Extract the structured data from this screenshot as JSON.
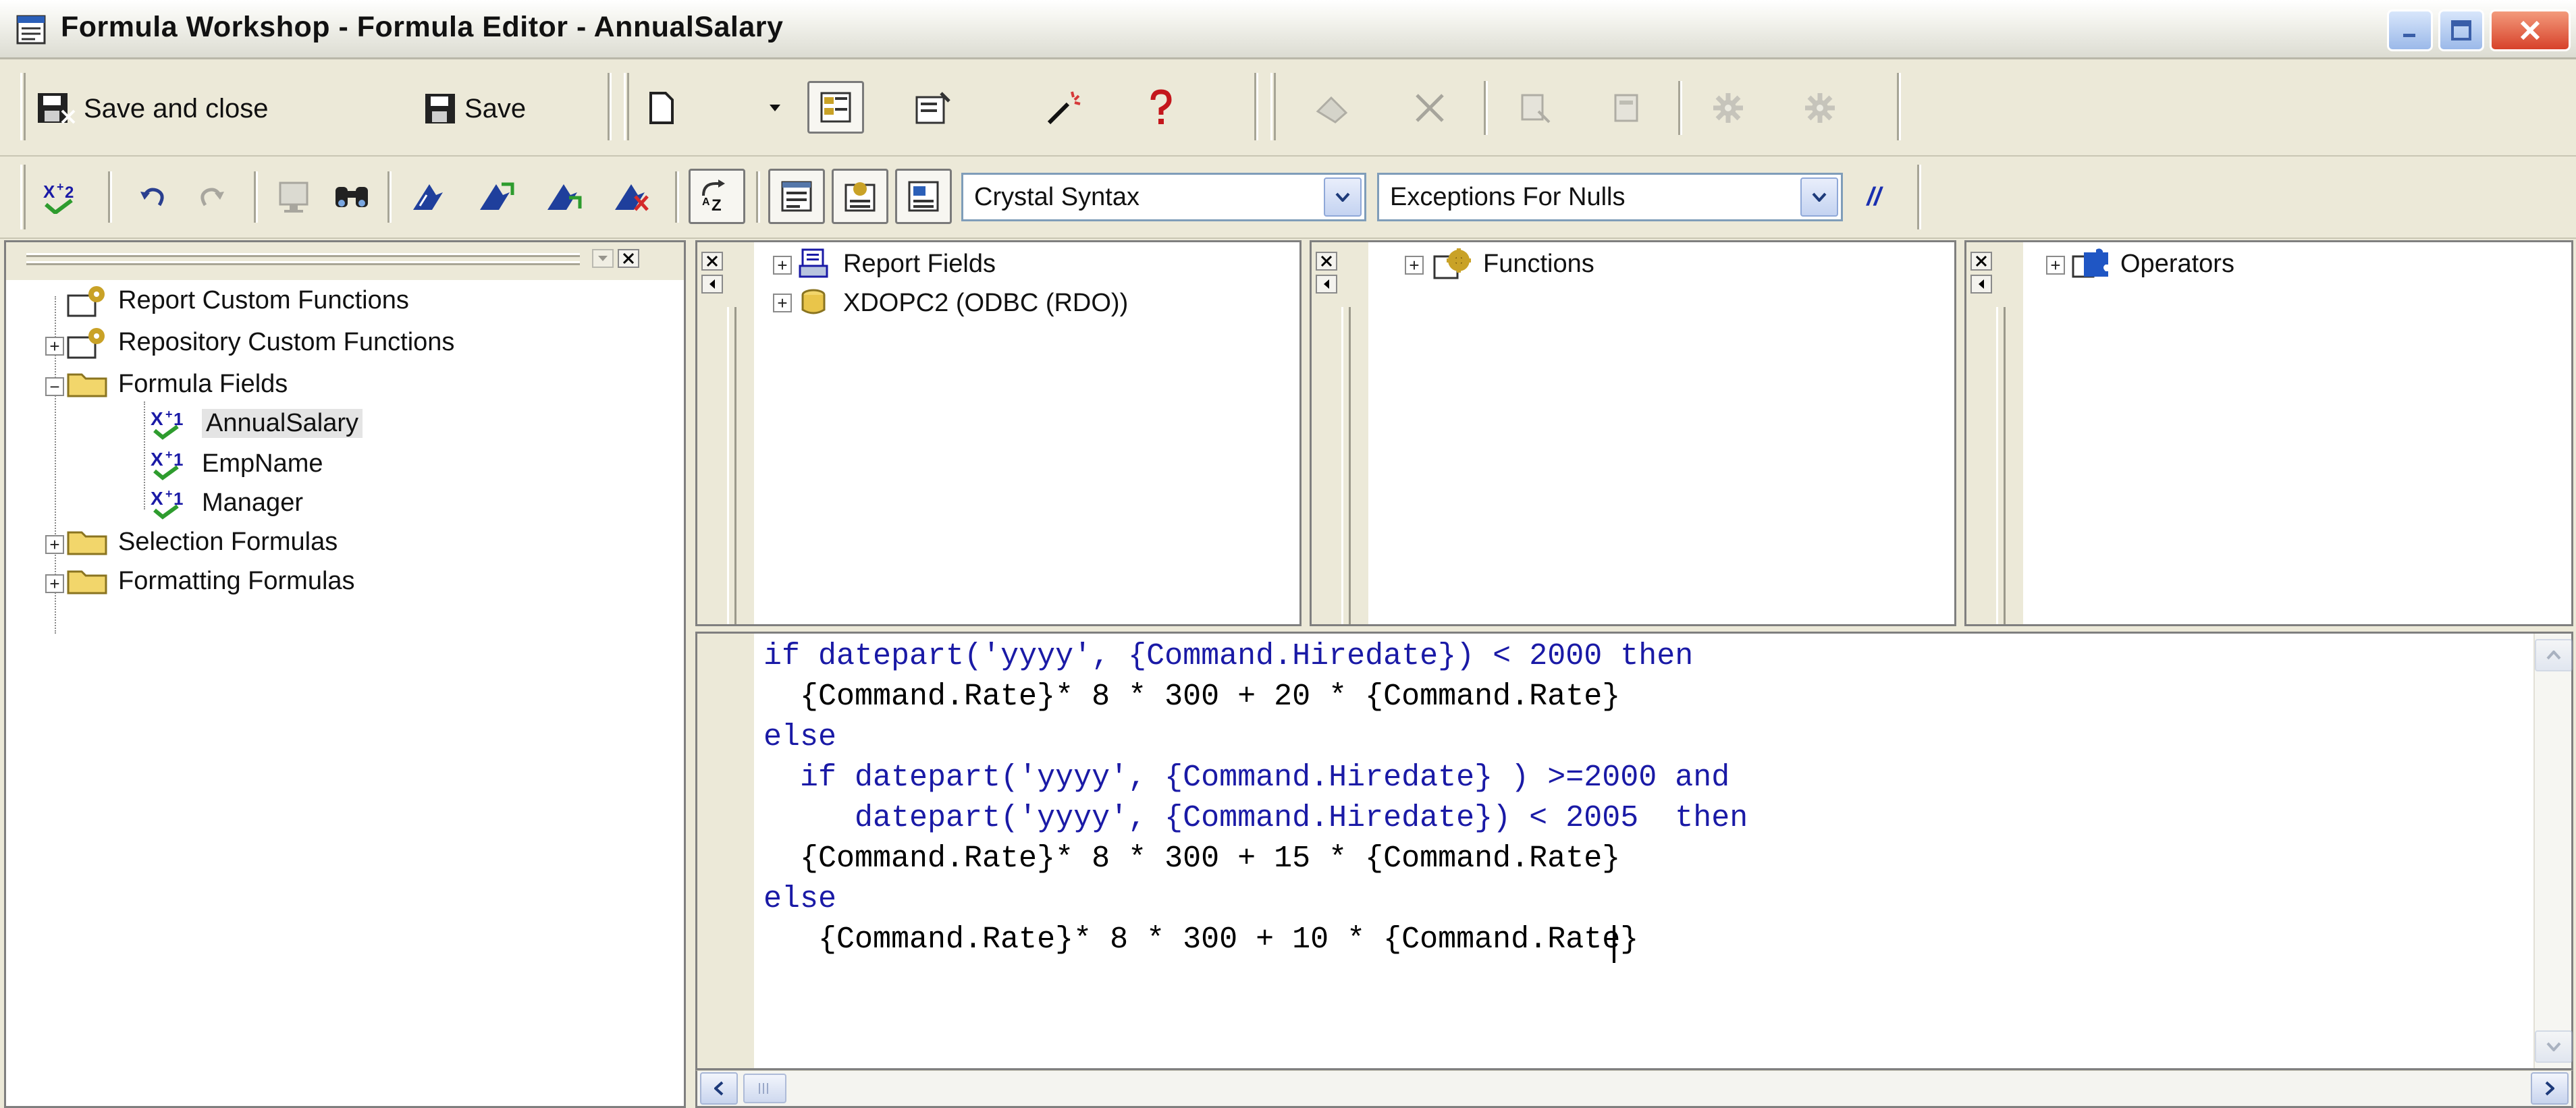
{
  "window": {
    "title": "Formula Workshop - Formula Editor - AnnualSalary"
  },
  "toolbar1": {
    "save_and_close_label": "Save and close",
    "save_label": "Save"
  },
  "toolbar2": {
    "syntax_selected": "Crystal Syntax",
    "null_handling_selected": "Exceptions For Nulls",
    "comment_glyph": "//"
  },
  "workshop_tree": {
    "items": [
      {
        "label": "Report Custom Functions",
        "icon": "custom-function-icon"
      },
      {
        "label": "Repository Custom Functions",
        "icon": "custom-function-icon"
      },
      {
        "label": "Formula Fields",
        "icon": "folder-icon"
      },
      {
        "label": "AnnualSalary",
        "icon": "formula-icon"
      },
      {
        "label": "EmpName",
        "icon": "formula-icon"
      },
      {
        "label": "Manager",
        "icon": "formula-icon"
      },
      {
        "label": "Selection Formulas",
        "icon": "folder-icon"
      },
      {
        "label": "Formatting Formulas",
        "icon": "folder-icon"
      }
    ]
  },
  "fields_panel": {
    "items": [
      {
        "label": "Report Fields",
        "icon": "report-fields-icon"
      },
      {
        "label": "XDOPC2 (ODBC (RDO))",
        "icon": "database-icon"
      }
    ]
  },
  "functions_panel": {
    "items": [
      {
        "label": "Functions",
        "icon": "functions-gear-icon"
      }
    ]
  },
  "operators_panel": {
    "items": [
      {
        "label": "Operators",
        "icon": "operators-puzzle-icon"
      }
    ]
  },
  "editor": {
    "lines": [
      {
        "kw1": "if",
        "mid": " datepart('yyyy', {Command.Hiredate}) < 2000 ",
        "kw2": "then",
        "end": ""
      },
      {
        "kw1": "",
        "mid": "  {Command.Rate}* 8 * 300 + 20 * {Command.Rate}",
        "kw2": "",
        "end": ""
      },
      {
        "kw1": "else",
        "mid": "",
        "kw2": "",
        "end": ""
      },
      {
        "kw1": "",
        "mid": "  if datepart('yyyy', {Command.Hiredate} ) >=2000 ",
        "kw2": "and",
        "end": ""
      },
      {
        "kw1": "",
        "mid": "     datepart('yyyy', {Command.Hiredate}) < 2005  ",
        "kw2": "then",
        "end": ""
      },
      {
        "kw1": "",
        "mid": "  {Command.Rate}* 8 * 300 + 15 * {Command.Rate}",
        "kw2": "",
        "end": ""
      },
      {
        "kw1": "else",
        "mid": "",
        "kw2": "",
        "end": ""
      },
      {
        "kw1": "",
        "mid": "   {Command.Rate}* 8 * 300 + 10 * {Command.Rate}",
        "kw2": "",
        "end": ""
      }
    ]
  },
  "colors": {
    "keyword": "#1a1aa6",
    "chrome": "#ece9d8",
    "close_button": "#d7422a"
  }
}
